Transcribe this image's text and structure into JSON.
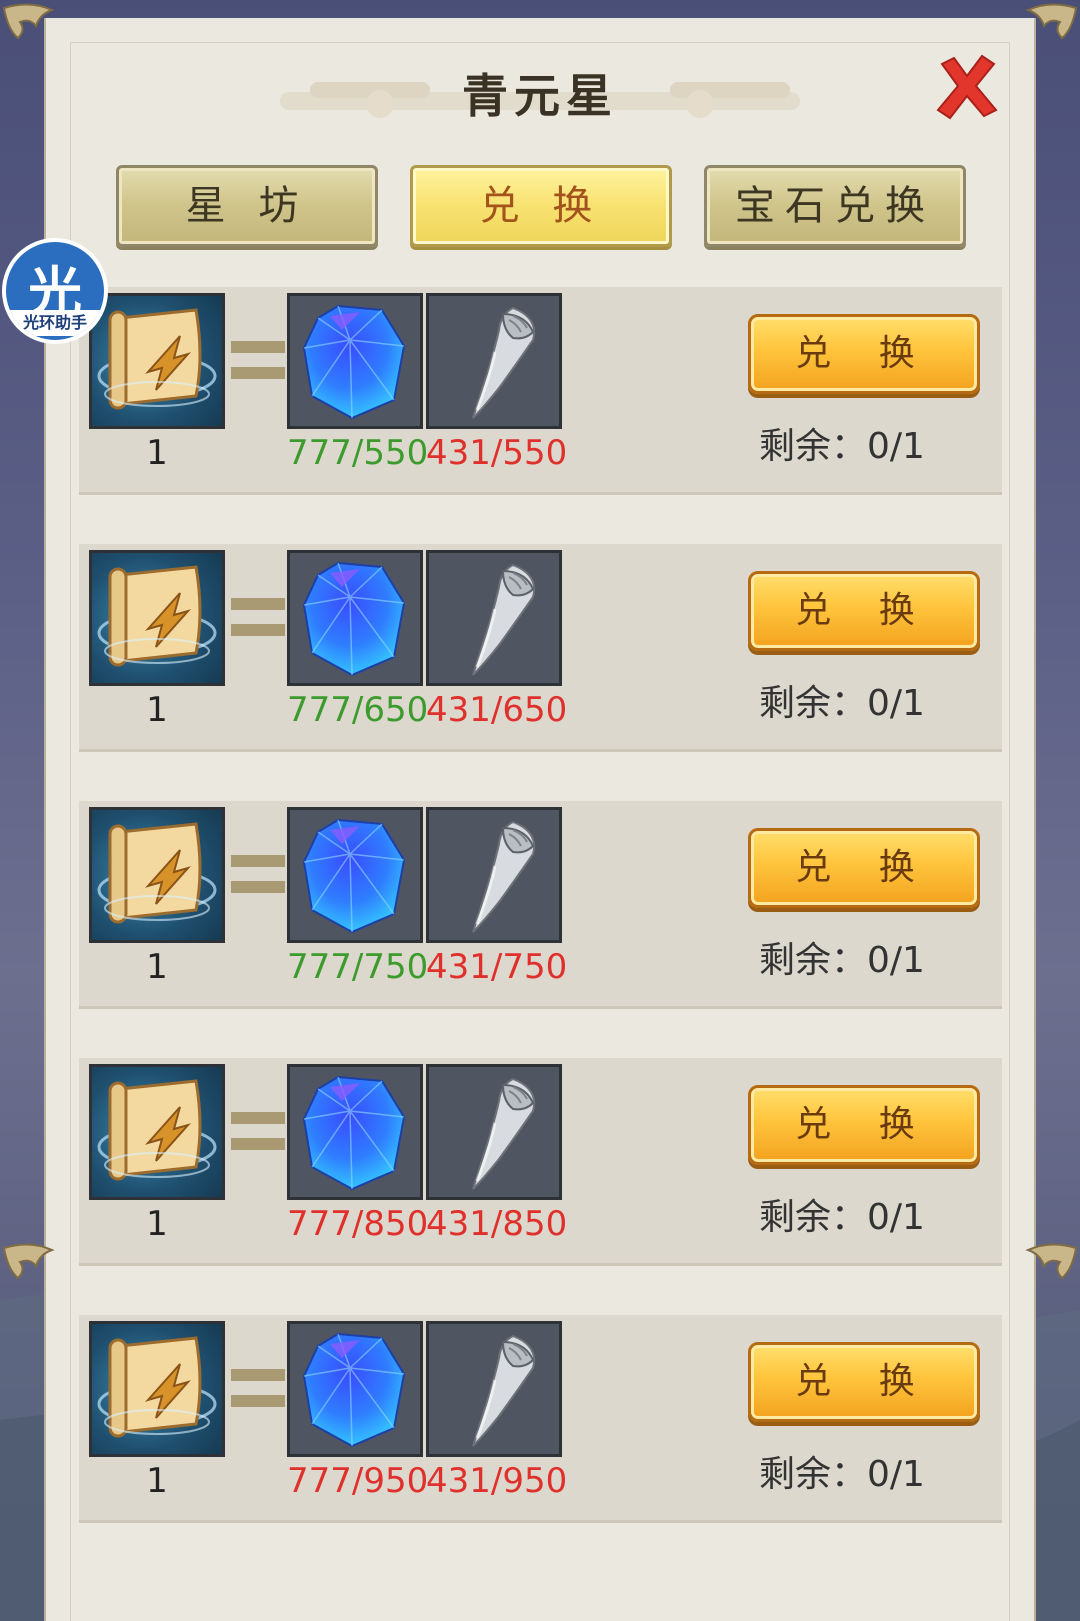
{
  "window": {
    "title": "青元星"
  },
  "tabs": [
    {
      "label": "星 坊",
      "active": false
    },
    {
      "label": "兑 换",
      "active": true
    },
    {
      "label": "宝石兑换",
      "active": false
    }
  ],
  "overlay_badge": {
    "char": "光",
    "label": "光环助手"
  },
  "rows": [
    {
      "reward_qty": "1",
      "gem_qty": "777/550",
      "fang_qty": "431/550",
      "gem_ok": true,
      "button": "兑 换",
      "remaining": "剩余：0/1"
    },
    {
      "reward_qty": "1",
      "gem_qty": "777/650",
      "fang_qty": "431/650",
      "gem_ok": true,
      "button": "兑 换",
      "remaining": "剩余：0/1"
    },
    {
      "reward_qty": "1",
      "gem_qty": "777/750",
      "fang_qty": "431/750",
      "gem_ok": true,
      "button": "兑 换",
      "remaining": "剩余：0/1"
    },
    {
      "reward_qty": "1",
      "gem_qty": "777/850",
      "fang_qty": "431/850",
      "gem_ok": false,
      "button": "兑 换",
      "remaining": "剩余：0/1"
    },
    {
      "reward_qty": "1",
      "gem_qty": "777/950",
      "fang_qty": "431/950",
      "gem_ok": false,
      "button": "兑 换",
      "remaining": "剩余：0/1"
    }
  ],
  "icons": {
    "reward": "scroll-icon",
    "cost_1": "blue-gem-icon",
    "cost_2": "silver-fang-icon",
    "close": "close-icon"
  },
  "colors": {
    "sufficient": "#3d9b2e",
    "insufficient": "#e0302c",
    "active_tab": "#f8e270",
    "exchange_button": "#ffc43c"
  }
}
